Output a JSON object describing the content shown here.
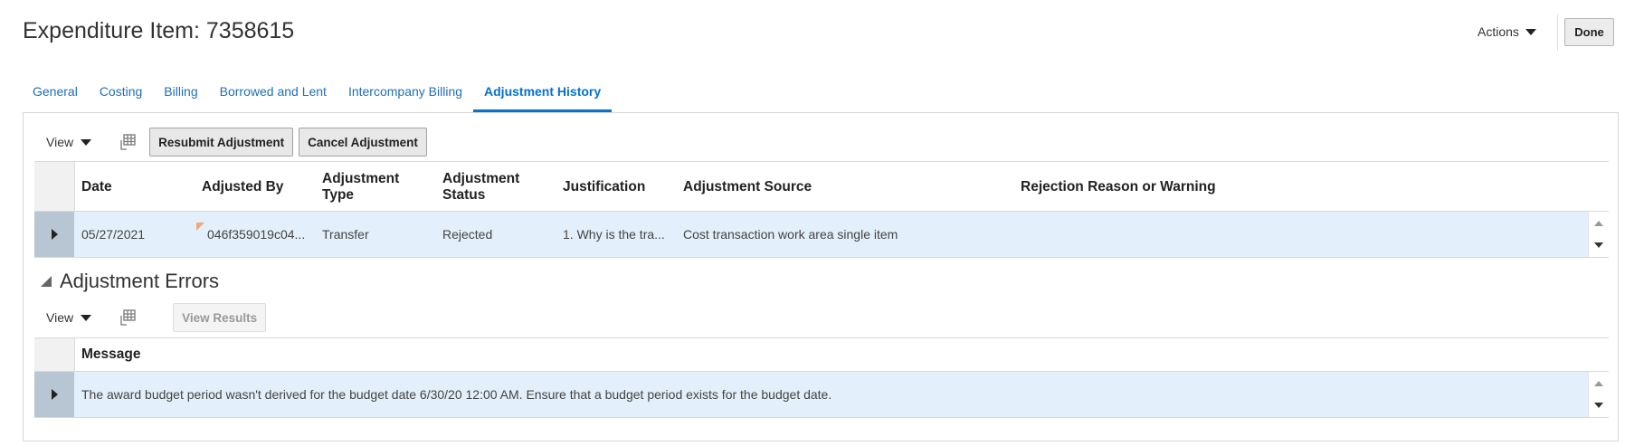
{
  "header": {
    "title": "Expenditure Item: 7358615",
    "actions_label": "Actions",
    "done_label": "Done"
  },
  "tabs": [
    {
      "label": "General"
    },
    {
      "label": "Costing"
    },
    {
      "label": "Billing"
    },
    {
      "label": "Borrowed and Lent"
    },
    {
      "label": "Intercompany Billing"
    },
    {
      "label": "Adjustment History",
      "active": true
    }
  ],
  "history": {
    "toolbar": {
      "view_label": "View",
      "resubmit_label": "Resubmit Adjustment",
      "cancel_label": "Cancel Adjustment"
    },
    "columns": {
      "date": "Date",
      "adjusted_by": "Adjusted By",
      "adj_type_1": "Adjustment",
      "adj_type_2": "Type",
      "adj_status_1": "Adjustment",
      "adj_status_2": "Status",
      "justification": "Justification",
      "source": "Adjustment Source",
      "rejection": "Rejection Reason or Warning"
    },
    "rows": [
      {
        "date": "05/27/2021",
        "adjusted_by": "046f359019c04...",
        "type": "Transfer",
        "status": "Rejected",
        "justification": "1. Why is the tra...",
        "source": "Cost transaction work area single item",
        "rejection": ""
      }
    ]
  },
  "errors": {
    "title": "Adjustment Errors",
    "toolbar": {
      "view_label": "View",
      "view_results_label": "View Results"
    },
    "columns": {
      "message": "Message"
    },
    "rows": [
      {
        "message": "The award budget period wasn't derived for the budget date 6/30/20 12:00 AM. Ensure that a budget period exists for the budget date."
      }
    ]
  },
  "colors": {
    "accent": "#0572ce",
    "row_selected": "#e3effa",
    "row_header": "#b8c6d3"
  }
}
